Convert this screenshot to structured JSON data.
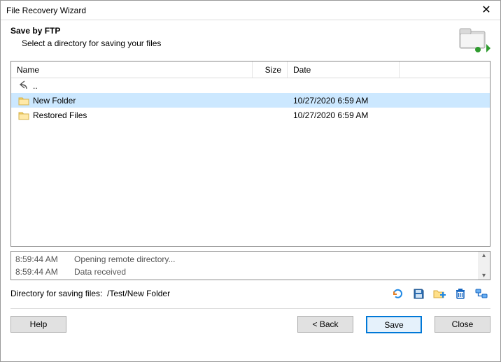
{
  "window": {
    "title": "File Recovery Wizard"
  },
  "header": {
    "title": "Save by FTP",
    "subtitle": "Select a directory for saving your files"
  },
  "columns": {
    "name": "Name",
    "size": "Size",
    "date": "Date"
  },
  "parent_link": "..",
  "rows": [
    {
      "name": "New Folder",
      "size": "",
      "date": "10/27/2020 6:59 AM",
      "selected": true
    },
    {
      "name": "Restored Files",
      "size": "",
      "date": "10/27/2020 6:59 AM",
      "selected": false
    }
  ],
  "log": [
    {
      "time": "8:59:44 AM",
      "msg": "Opening remote directory..."
    },
    {
      "time": "8:59:44 AM",
      "msg": "Data received"
    }
  ],
  "path": {
    "label": "Directory for saving files:",
    "value": "/Test/New Folder"
  },
  "buttons": {
    "help": "Help",
    "back": "< Back",
    "save": "Save",
    "close": "Close"
  }
}
